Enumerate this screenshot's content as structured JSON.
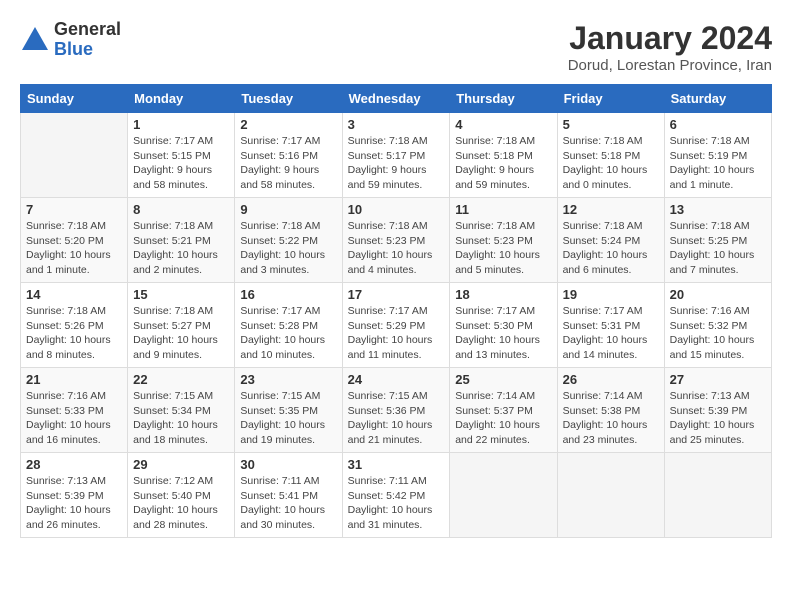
{
  "logo": {
    "general": "General",
    "blue": "Blue"
  },
  "title": "January 2024",
  "subtitle": "Dorud, Lorestan Province, Iran",
  "weekdays": [
    "Sunday",
    "Monday",
    "Tuesday",
    "Wednesday",
    "Thursday",
    "Friday",
    "Saturday"
  ],
  "weeks": [
    [
      {
        "day": "",
        "info": ""
      },
      {
        "day": "1",
        "info": "Sunrise: 7:17 AM\nSunset: 5:15 PM\nDaylight: 9 hours\nand 58 minutes."
      },
      {
        "day": "2",
        "info": "Sunrise: 7:17 AM\nSunset: 5:16 PM\nDaylight: 9 hours\nand 58 minutes."
      },
      {
        "day": "3",
        "info": "Sunrise: 7:18 AM\nSunset: 5:17 PM\nDaylight: 9 hours\nand 59 minutes."
      },
      {
        "day": "4",
        "info": "Sunrise: 7:18 AM\nSunset: 5:18 PM\nDaylight: 9 hours\nand 59 minutes."
      },
      {
        "day": "5",
        "info": "Sunrise: 7:18 AM\nSunset: 5:18 PM\nDaylight: 10 hours\nand 0 minutes."
      },
      {
        "day": "6",
        "info": "Sunrise: 7:18 AM\nSunset: 5:19 PM\nDaylight: 10 hours\nand 1 minute."
      }
    ],
    [
      {
        "day": "7",
        "info": "Sunrise: 7:18 AM\nSunset: 5:20 PM\nDaylight: 10 hours\nand 1 minute."
      },
      {
        "day": "8",
        "info": "Sunrise: 7:18 AM\nSunset: 5:21 PM\nDaylight: 10 hours\nand 2 minutes."
      },
      {
        "day": "9",
        "info": "Sunrise: 7:18 AM\nSunset: 5:22 PM\nDaylight: 10 hours\nand 3 minutes."
      },
      {
        "day": "10",
        "info": "Sunrise: 7:18 AM\nSunset: 5:23 PM\nDaylight: 10 hours\nand 4 minutes."
      },
      {
        "day": "11",
        "info": "Sunrise: 7:18 AM\nSunset: 5:23 PM\nDaylight: 10 hours\nand 5 minutes."
      },
      {
        "day": "12",
        "info": "Sunrise: 7:18 AM\nSunset: 5:24 PM\nDaylight: 10 hours\nand 6 minutes."
      },
      {
        "day": "13",
        "info": "Sunrise: 7:18 AM\nSunset: 5:25 PM\nDaylight: 10 hours\nand 7 minutes."
      }
    ],
    [
      {
        "day": "14",
        "info": "Sunrise: 7:18 AM\nSunset: 5:26 PM\nDaylight: 10 hours\nand 8 minutes."
      },
      {
        "day": "15",
        "info": "Sunrise: 7:18 AM\nSunset: 5:27 PM\nDaylight: 10 hours\nand 9 minutes."
      },
      {
        "day": "16",
        "info": "Sunrise: 7:17 AM\nSunset: 5:28 PM\nDaylight: 10 hours\nand 10 minutes."
      },
      {
        "day": "17",
        "info": "Sunrise: 7:17 AM\nSunset: 5:29 PM\nDaylight: 10 hours\nand 11 minutes."
      },
      {
        "day": "18",
        "info": "Sunrise: 7:17 AM\nSunset: 5:30 PM\nDaylight: 10 hours\nand 13 minutes."
      },
      {
        "day": "19",
        "info": "Sunrise: 7:17 AM\nSunset: 5:31 PM\nDaylight: 10 hours\nand 14 minutes."
      },
      {
        "day": "20",
        "info": "Sunrise: 7:16 AM\nSunset: 5:32 PM\nDaylight: 10 hours\nand 15 minutes."
      }
    ],
    [
      {
        "day": "21",
        "info": "Sunrise: 7:16 AM\nSunset: 5:33 PM\nDaylight: 10 hours\nand 16 minutes."
      },
      {
        "day": "22",
        "info": "Sunrise: 7:15 AM\nSunset: 5:34 PM\nDaylight: 10 hours\nand 18 minutes."
      },
      {
        "day": "23",
        "info": "Sunrise: 7:15 AM\nSunset: 5:35 PM\nDaylight: 10 hours\nand 19 minutes."
      },
      {
        "day": "24",
        "info": "Sunrise: 7:15 AM\nSunset: 5:36 PM\nDaylight: 10 hours\nand 21 minutes."
      },
      {
        "day": "25",
        "info": "Sunrise: 7:14 AM\nSunset: 5:37 PM\nDaylight: 10 hours\nand 22 minutes."
      },
      {
        "day": "26",
        "info": "Sunrise: 7:14 AM\nSunset: 5:38 PM\nDaylight: 10 hours\nand 23 minutes."
      },
      {
        "day": "27",
        "info": "Sunrise: 7:13 AM\nSunset: 5:39 PM\nDaylight: 10 hours\nand 25 minutes."
      }
    ],
    [
      {
        "day": "28",
        "info": "Sunrise: 7:13 AM\nSunset: 5:39 PM\nDaylight: 10 hours\nand 26 minutes."
      },
      {
        "day": "29",
        "info": "Sunrise: 7:12 AM\nSunset: 5:40 PM\nDaylight: 10 hours\nand 28 minutes."
      },
      {
        "day": "30",
        "info": "Sunrise: 7:11 AM\nSunset: 5:41 PM\nDaylight: 10 hours\nand 30 minutes."
      },
      {
        "day": "31",
        "info": "Sunrise: 7:11 AM\nSunset: 5:42 PM\nDaylight: 10 hours\nand 31 minutes."
      },
      {
        "day": "",
        "info": ""
      },
      {
        "day": "",
        "info": ""
      },
      {
        "day": "",
        "info": ""
      }
    ]
  ]
}
